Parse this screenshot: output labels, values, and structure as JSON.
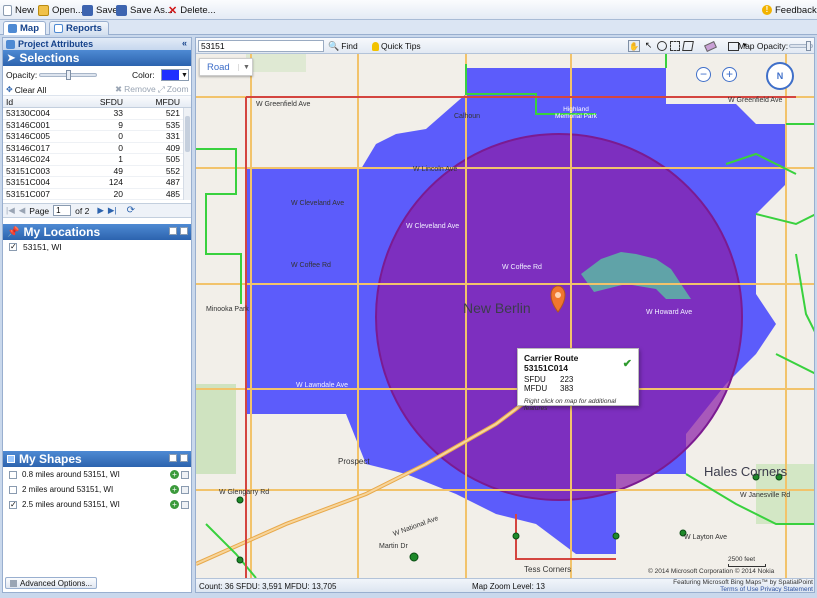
{
  "toolbar": {
    "new": "New",
    "open": "Open...",
    "save": "Save",
    "save_as": "Save As...",
    "delete": "Delete...",
    "feedback": "Feedback..."
  },
  "tabs": [
    {
      "label": "Map",
      "active": true
    },
    {
      "label": "Reports",
      "active": false
    }
  ],
  "project_attributes": {
    "title": "Project Attributes"
  },
  "selections": {
    "title": "Selections",
    "opacity_label": "Opacity:",
    "color_label": "Color:",
    "color_value": "#1f2fff",
    "clear_all": "Clear All",
    "remove": "Remove",
    "zoom": "Zoom",
    "columns": [
      "Id",
      "SFDU",
      "MFDU"
    ],
    "rows": [
      [
        "53130C004",
        "33",
        "521"
      ],
      [
        "53146C001",
        "9",
        "535"
      ],
      [
        "53146C005",
        "0",
        "331"
      ],
      [
        "53146C017",
        "0",
        "409"
      ],
      [
        "53146C024",
        "1",
        "505"
      ],
      [
        "53151C003",
        "49",
        "552"
      ],
      [
        "53151C004",
        "124",
        "487"
      ],
      [
        "53151C007",
        "20",
        "485"
      ]
    ],
    "pager": {
      "page_label": "Page",
      "page_value": "1",
      "of_label": "of 2"
    }
  },
  "my_locations": {
    "title": "My Locations",
    "items": [
      {
        "label": "53151, WI",
        "checked": true
      }
    ]
  },
  "my_shapes": {
    "title": "My Shapes",
    "items": [
      {
        "label": "0.8 miles around 53151, WI",
        "checked": false
      },
      {
        "label": "2 miles around 53151, WI",
        "checked": false
      },
      {
        "label": "2.5 miles around 53151, WI",
        "checked": true
      }
    ]
  },
  "advanced_options": "Advanced Options...",
  "map_tools": {
    "search_value": "53151",
    "find": "Find",
    "quick_tips": "Quick Tips",
    "map_opacity": "Map Opacity:",
    "road": "Road"
  },
  "popup": {
    "title": "Carrier Route 53151C014",
    "sfdu_label": "SFDU",
    "sfdu_value": "223",
    "mfdu_label": "MFDU",
    "mfdu_value": "383",
    "note": "Right click on map for additional features"
  },
  "map_labels": {
    "city_new_berlin": "New Berlin",
    "city_hales_corners": "Hales Corners",
    "calhoun": "Calhoun",
    "minooka_park": "Minooka Park",
    "prospect": "Prospect",
    "tess_corners": "Tess Corners",
    "highland_park": "Highland Memorial Park",
    "w_greenfield_ave": "W Greenfield Ave",
    "w_lincoln_ave": "W Lincoln Ave",
    "w_cleveland_ave": "W Cleveland Ave",
    "w_coffee_rd": "W Coffee Rd",
    "w_howard_ave": "W Howard Ave",
    "w_national_ave": "W National Ave",
    "w_janesville_rd": "W Janesville Rd",
    "w_glengarry_rd": "W Glengarry Rd",
    "w_lawndale_ave": "W Lawndale Ave",
    "martin_dr": "Martin Dr",
    "w_layton_ave": "W Layton Ave"
  },
  "map_attrib": {
    "copyright": "© 2014 Microsoft Corporation  © 2014 Nokia",
    "scale": "2500 feet",
    "featuring": "Featuring Microsoft Bing Maps™ by SpatialPoint",
    "terms": "Terms of Use  Privacy Statement"
  },
  "status": {
    "count": "Count: 36 SFDU: 3,591 MFDU: 13,705",
    "zoom_level": "Map Zoom Level: 13"
  },
  "colors": {
    "selection_fill": "#3a3cff",
    "circle_fill": "#8b1fa8",
    "header_blue": "#2c63ae",
    "boundary_green": "#39d13e"
  }
}
